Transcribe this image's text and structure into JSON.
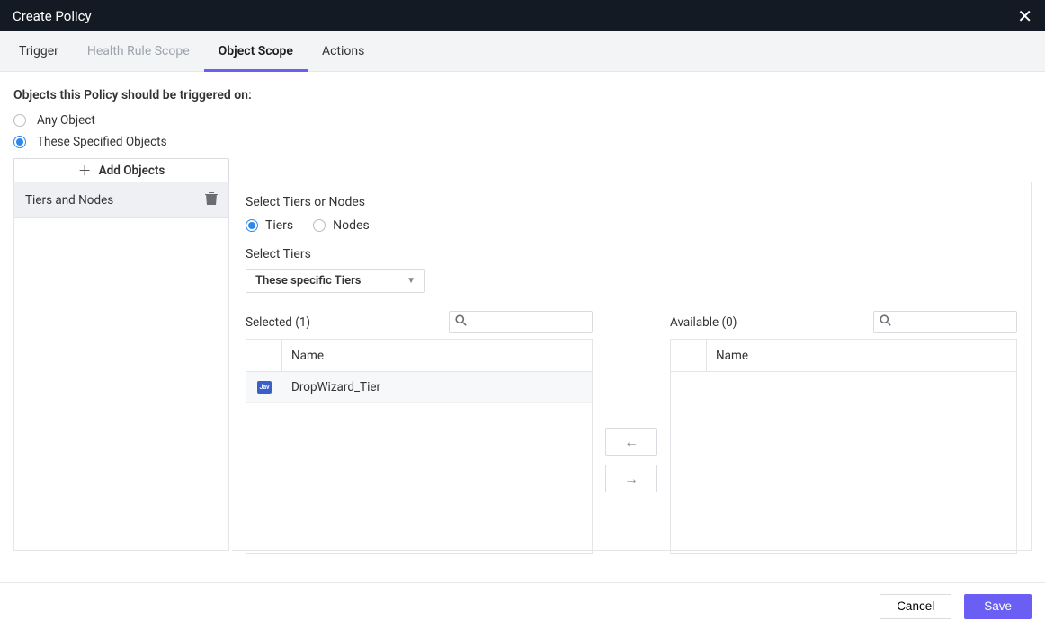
{
  "header": {
    "title": "Create Policy"
  },
  "tabs": {
    "trigger": "Trigger",
    "health_rule_scope": "Health Rule Scope",
    "object_scope": "Object Scope",
    "actions": "Actions"
  },
  "section": {
    "title": "Objects this Policy should be triggered on:",
    "radio_any": "Any Object",
    "radio_specified": "These Specified Objects",
    "add_objects": "Add Objects"
  },
  "object_types": {
    "tiers_and_nodes": "Tiers and Nodes"
  },
  "panel": {
    "select_title": "Select Tiers or Nodes",
    "radio_tiers": "Tiers",
    "radio_nodes": "Nodes",
    "select_tiers": "Select Tiers",
    "dropdown": "These specific Tiers",
    "selected_label": "Selected (1)",
    "available_label": "Available (0)",
    "col_name": "Name",
    "col_name2": "Name"
  },
  "selected_rows": {
    "r0": {
      "name": "DropWizard_Tier",
      "icon_text": "Jav"
    }
  },
  "footer": {
    "cancel": "Cancel",
    "save": "Save"
  }
}
